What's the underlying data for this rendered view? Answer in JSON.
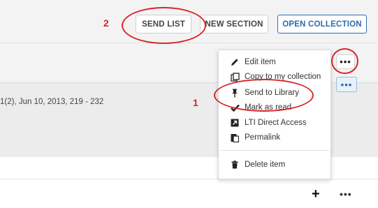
{
  "toolbar": {
    "send_list_label": "SEND LIST",
    "new_section_label": "NEW SECTION",
    "open_collection_label": "OPEN COLLECTION"
  },
  "item": {
    "citation": "1(2), Jun 10, 2013, 219 - 232"
  },
  "item_menu": {
    "items": [
      {
        "label": "Edit item",
        "icon": "pencil-icon"
      },
      {
        "label": "Copy to my collection",
        "icon": "copy-icon"
      },
      {
        "label": "Send to Library",
        "icon": "pin-icon"
      },
      {
        "label": "Mark as read",
        "icon": "check-icon"
      },
      {
        "label": "LTI Direct Access",
        "icon": "external-link-icon"
      },
      {
        "label": "Permalink",
        "icon": "clipboard-icon"
      },
      {
        "label": "Delete item",
        "icon": "trash-icon"
      }
    ]
  },
  "annotations": {
    "marker_1": "1",
    "marker_2": "2"
  },
  "more_label": "•••",
  "add_label": "+",
  "colors": {
    "accent": "#2b6cb0",
    "annotation": "#d8262b",
    "panel_bg": "#f3f3f3",
    "row_bg": "#ececec"
  }
}
